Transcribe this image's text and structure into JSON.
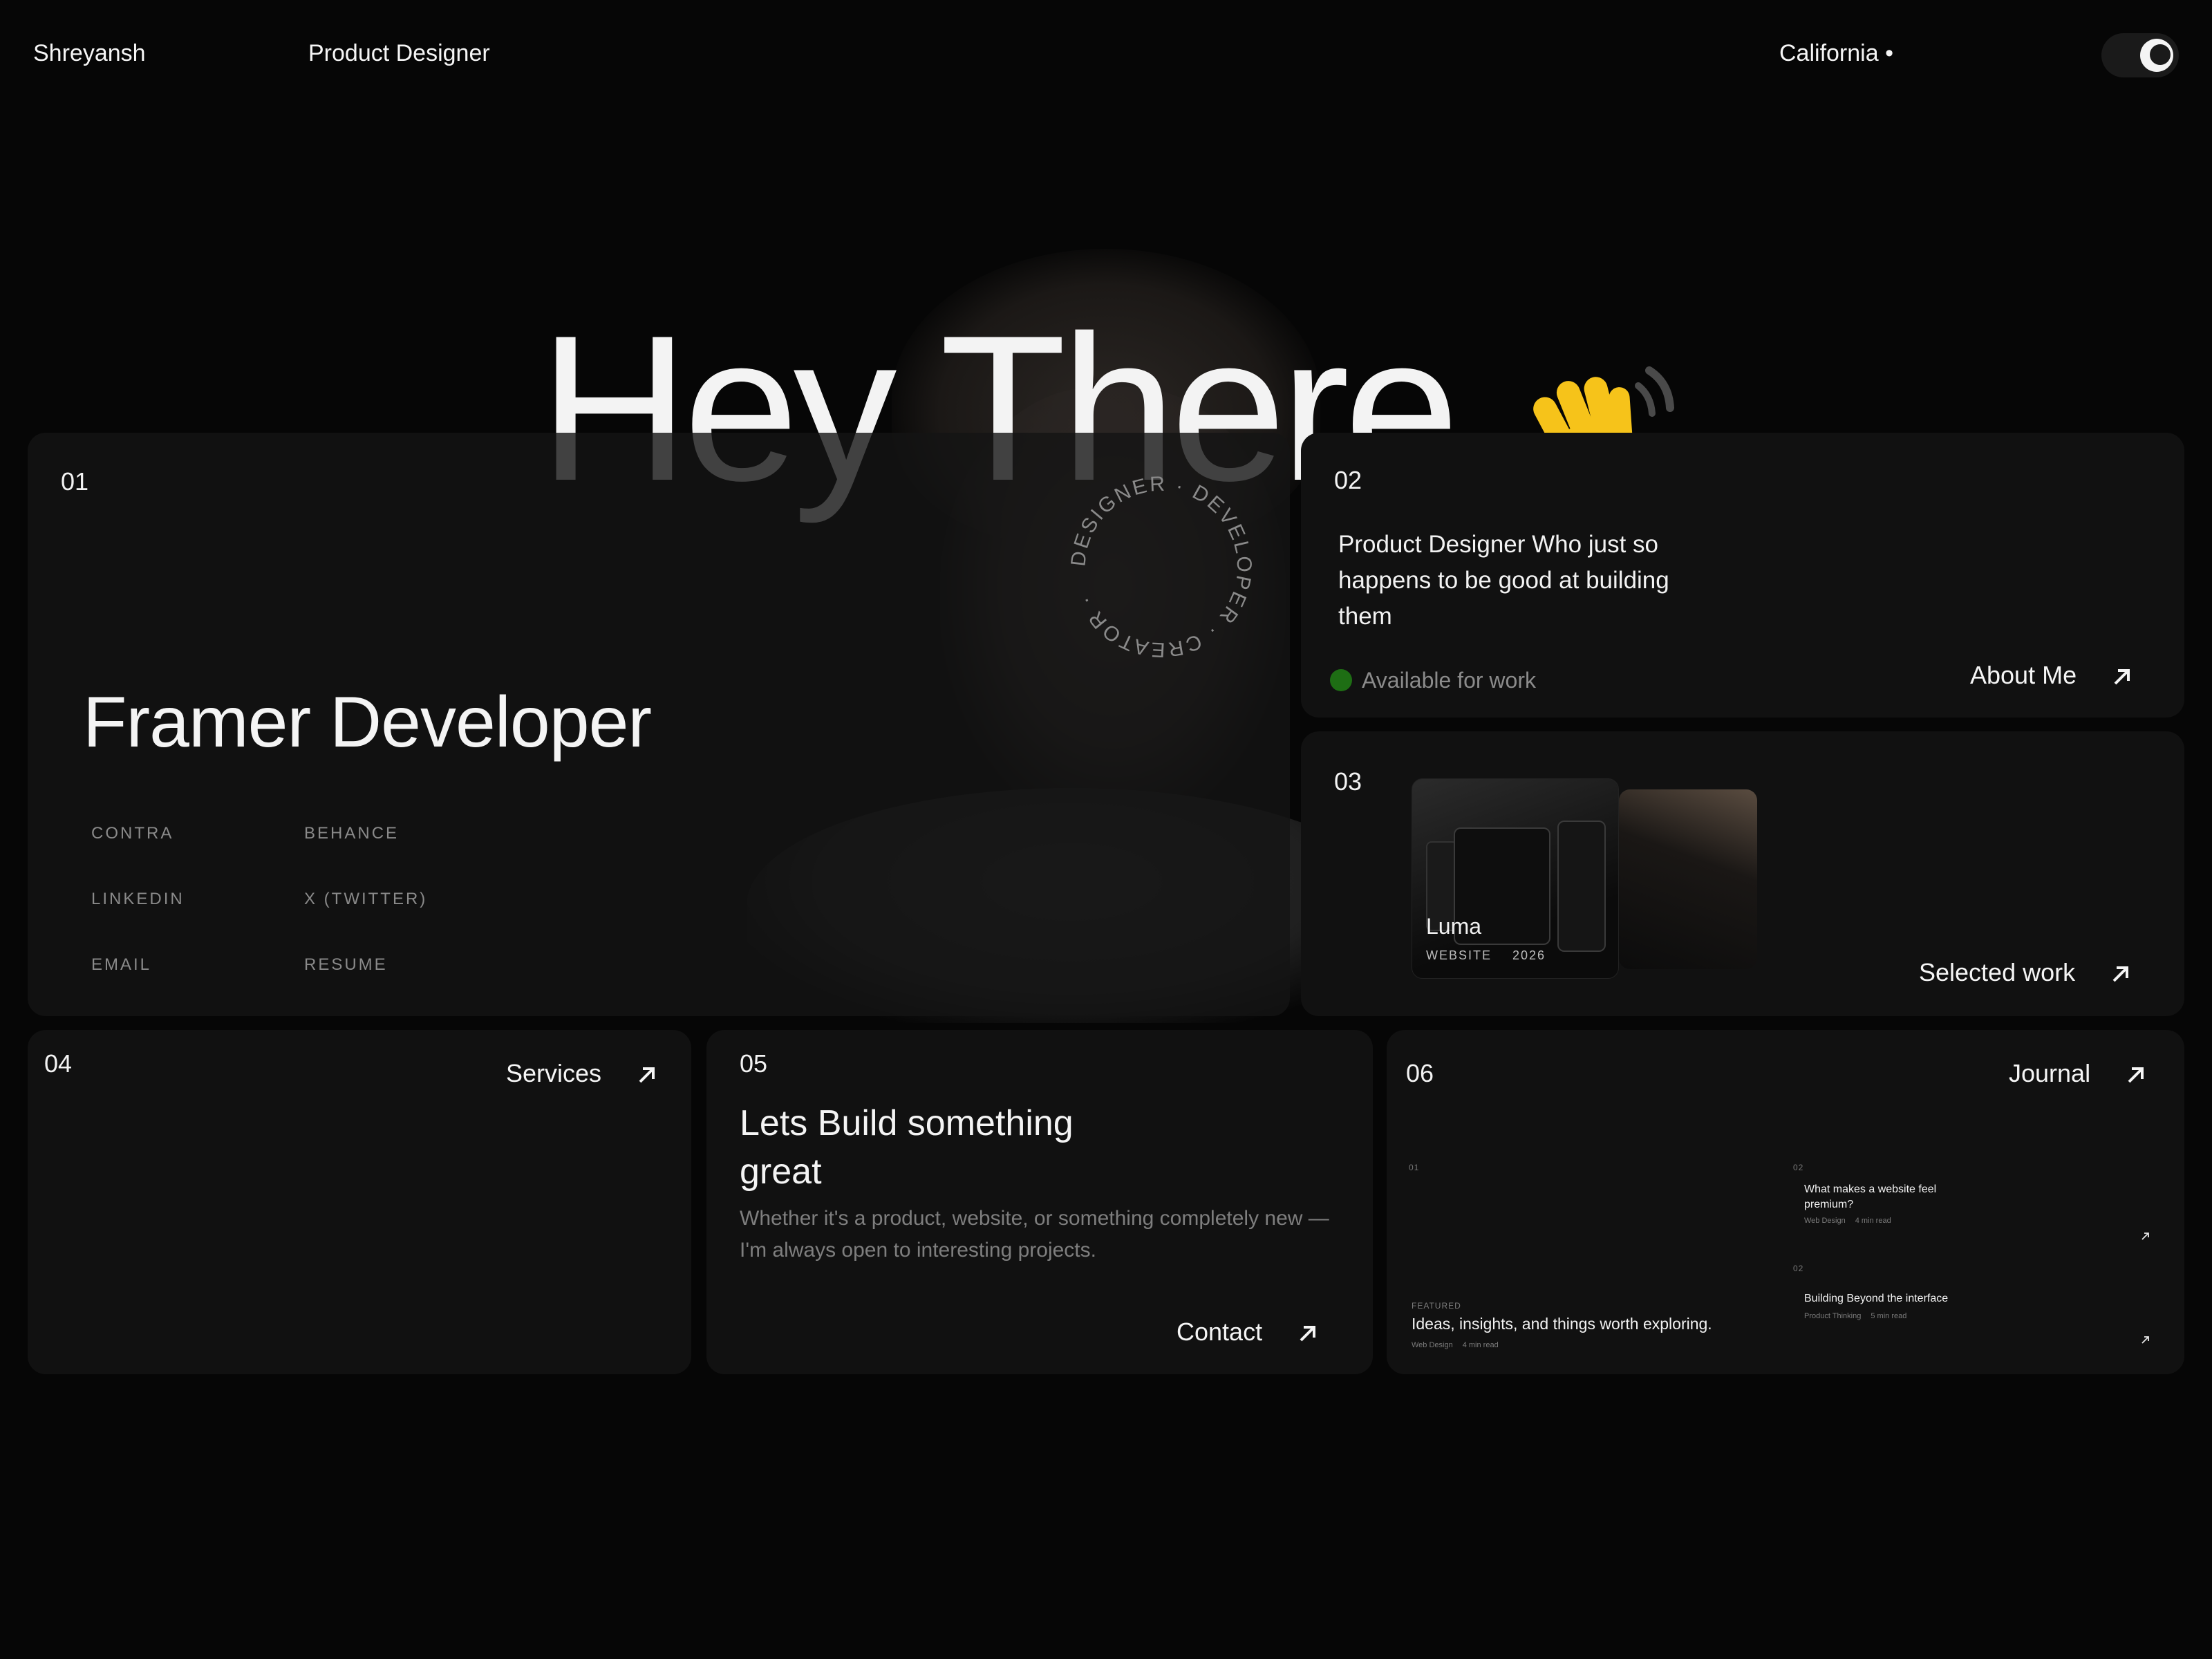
{
  "header": {
    "name": "Shreyansh",
    "role": "Product Designer",
    "location": "California •",
    "theme_toggle_icon": "moon-icon"
  },
  "hero": {
    "greeting": "Hey There",
    "wave_icon": "waving-hand-icon",
    "badge_text": "DESIGNER · DEVELOPER · CREATOR ·"
  },
  "card1": {
    "number": "01",
    "title": "Framer Developer",
    "links": [
      "CONTRA",
      "BEHANCE",
      "LINKEDIN",
      "X (TWITTER)",
      "EMAIL",
      "RESUME"
    ]
  },
  "card2": {
    "number": "02",
    "text": "Product Designer Who just so happens to be good at building them",
    "status": "Available for work",
    "status_color": "#1e6e14",
    "link": "About Me"
  },
  "card3": {
    "number": "03",
    "project_name": "Luma",
    "project_type": "WEBSITE",
    "project_year": "2026",
    "link": "Selected work"
  },
  "card4": {
    "number": "04",
    "link": "Services"
  },
  "card5": {
    "number": "05",
    "title": "Lets Build something great",
    "body": "Whether it's a product, website, or something completely new — I'm always open to interesting projects.",
    "link": "Contact"
  },
  "card6": {
    "number": "06",
    "link": "Journal",
    "featured": {
      "number": "01",
      "label": "FEATURED",
      "title": "Ideas, insights, and things worth exploring.",
      "category": "Web Design",
      "read": "4 min read"
    },
    "articles": [
      {
        "number": "02",
        "title": "What makes a website feel premium?",
        "category": "Web Design",
        "read": "4 min read"
      },
      {
        "number": "02",
        "title": "Building Beyond the interface",
        "category": "Product Thinking",
        "read": "5 min read"
      }
    ]
  }
}
